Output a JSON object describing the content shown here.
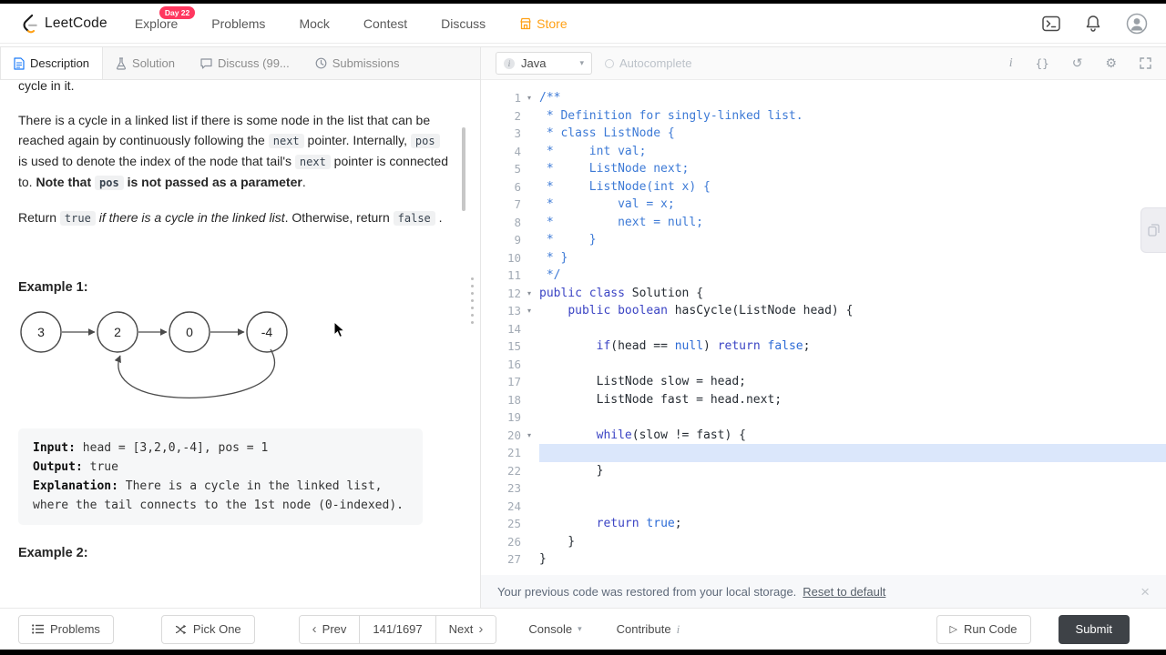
{
  "nav": {
    "brand": "LeetCode",
    "items": [
      {
        "label": "Explore",
        "badge": "Day 22"
      },
      {
        "label": "Problems"
      },
      {
        "label": "Mock"
      },
      {
        "label": "Contest"
      },
      {
        "label": "Discuss"
      },
      {
        "label": "Store"
      }
    ]
  },
  "left_tabs": [
    {
      "label": "Description"
    },
    {
      "label": "Solution"
    },
    {
      "label": "Discuss (99..."
    },
    {
      "label": "Submissions"
    }
  ],
  "description": {
    "clipped_line": "cycle in it.",
    "p1": [
      [
        "n",
        "There is a cycle in a linked list if there is some node in the list that can be reached again by continuously following the "
      ],
      [
        "c",
        "next"
      ],
      [
        "n",
        " pointer. Internally, "
      ],
      [
        "c",
        "pos"
      ],
      [
        "n",
        " is used to denote the index of the node that tail's "
      ],
      [
        "c",
        "next"
      ],
      [
        "n",
        " pointer is connected to. "
      ],
      [
        "b",
        "Note that "
      ],
      [
        "bc",
        "pos"
      ],
      [
        "b",
        " is not passed as a parameter"
      ],
      [
        "n",
        "."
      ]
    ],
    "p2": [
      [
        "n",
        "Return "
      ],
      [
        "c",
        "true"
      ],
      [
        "i",
        " if there is a cycle in the linked list"
      ],
      [
        "n",
        ". Otherwise, return "
      ],
      [
        "c",
        "false"
      ],
      [
        "n",
        " ."
      ]
    ],
    "example1_title": "Example 1:",
    "example2_title": "Example 2:",
    "diagram": {
      "nodes": [
        "3",
        "2",
        "0",
        "-4"
      ]
    },
    "example1_rows": [
      {
        "label": "Input:",
        "text": " head = [3,2,0,-4], pos = 1"
      },
      {
        "label": "Output:",
        "text": " true"
      },
      {
        "label": "Explanation:",
        "text": " There is a cycle in the linked list, where the tail connects to the 1st node (0-indexed)."
      }
    ]
  },
  "editor": {
    "language": "Java",
    "autocomplete_label": "Autocomplete",
    "active_line": 21,
    "lines": [
      {
        "n": 1,
        "fold": true,
        "tokens": [
          [
            "c",
            "/**"
          ]
        ]
      },
      {
        "n": 2,
        "tokens": [
          [
            "c",
            " * Definition for singly-linked list."
          ]
        ]
      },
      {
        "n": 3,
        "tokens": [
          [
            "c",
            " * class ListNode {"
          ]
        ]
      },
      {
        "n": 4,
        "tokens": [
          [
            "c",
            " *     int val;"
          ]
        ]
      },
      {
        "n": 5,
        "tokens": [
          [
            "c",
            " *     ListNode next;"
          ]
        ]
      },
      {
        "n": 6,
        "tokens": [
          [
            "c",
            " *     ListNode(int x) {"
          ]
        ]
      },
      {
        "n": 7,
        "tokens": [
          [
            "c",
            " *         val = x;"
          ]
        ]
      },
      {
        "n": 8,
        "tokens": [
          [
            "c",
            " *         next = null;"
          ]
        ]
      },
      {
        "n": 9,
        "tokens": [
          [
            "c",
            " *     }"
          ]
        ]
      },
      {
        "n": 10,
        "tokens": [
          [
            "c",
            " * }"
          ]
        ]
      },
      {
        "n": 11,
        "tokens": [
          [
            "c",
            " */"
          ]
        ]
      },
      {
        "n": 12,
        "fold": true,
        "tokens": [
          [
            "k",
            "public"
          ],
          [
            "p",
            " "
          ],
          [
            "k",
            "class"
          ],
          [
            "p",
            " Solution {"
          ]
        ]
      },
      {
        "n": 13,
        "fold": true,
        "tokens": [
          [
            "p",
            "    "
          ],
          [
            "k",
            "public"
          ],
          [
            "p",
            " "
          ],
          [
            "k",
            "boolean"
          ],
          [
            "p",
            " hasCycle(ListNode head) {"
          ]
        ]
      },
      {
        "n": 14,
        "tokens": []
      },
      {
        "n": 15,
        "tokens": [
          [
            "p",
            "        "
          ],
          [
            "k",
            "if"
          ],
          [
            "p",
            "(head == "
          ],
          [
            "a",
            "null"
          ],
          [
            "p",
            ") "
          ],
          [
            "k",
            "return"
          ],
          [
            "p",
            " "
          ],
          [
            "a",
            "false"
          ],
          [
            "p",
            ";"
          ]
        ]
      },
      {
        "n": 16,
        "tokens": []
      },
      {
        "n": 17,
        "tokens": [
          [
            "p",
            "        ListNode slow = head;"
          ]
        ]
      },
      {
        "n": 18,
        "tokens": [
          [
            "p",
            "        ListNode fast = head.next;"
          ]
        ]
      },
      {
        "n": 19,
        "tokens": []
      },
      {
        "n": 20,
        "fold": true,
        "tokens": [
          [
            "p",
            "        "
          ],
          [
            "k",
            "while"
          ],
          [
            "p",
            "(slow != fast) {"
          ]
        ]
      },
      {
        "n": 21,
        "tokens": []
      },
      {
        "n": 22,
        "tokens": [
          [
            "p",
            "        }"
          ]
        ]
      },
      {
        "n": 23,
        "tokens": []
      },
      {
        "n": 24,
        "tokens": []
      },
      {
        "n": 25,
        "tokens": [
          [
            "p",
            "        "
          ],
          [
            "k",
            "return"
          ],
          [
            "p",
            " "
          ],
          [
            "a",
            "true"
          ],
          [
            "p",
            ";"
          ]
        ]
      },
      {
        "n": 26,
        "tokens": [
          [
            "p",
            "    }"
          ]
        ]
      },
      {
        "n": 27,
        "tokens": [
          [
            "p",
            "}"
          ]
        ]
      }
    ]
  },
  "restore_bar": {
    "message": "Your previous code was restored from your local storage.",
    "link": "Reset to default"
  },
  "footer": {
    "problems": "Problems",
    "pick_one": "Pick One",
    "prev": "Prev",
    "counter": "141/1697",
    "next": "Next",
    "console": "Console",
    "contribute": "Contribute",
    "run_code": "Run Code",
    "submit": "Submit"
  },
  "colors": {
    "brand_orange": "#ffa116",
    "badge_pink": "#ff375f",
    "active_line_highlight": "#dbe7fb",
    "submit_bg": "#3e4247",
    "comment_blue": "#3d7ad6",
    "keyword_indigo": "#3b44c4"
  }
}
